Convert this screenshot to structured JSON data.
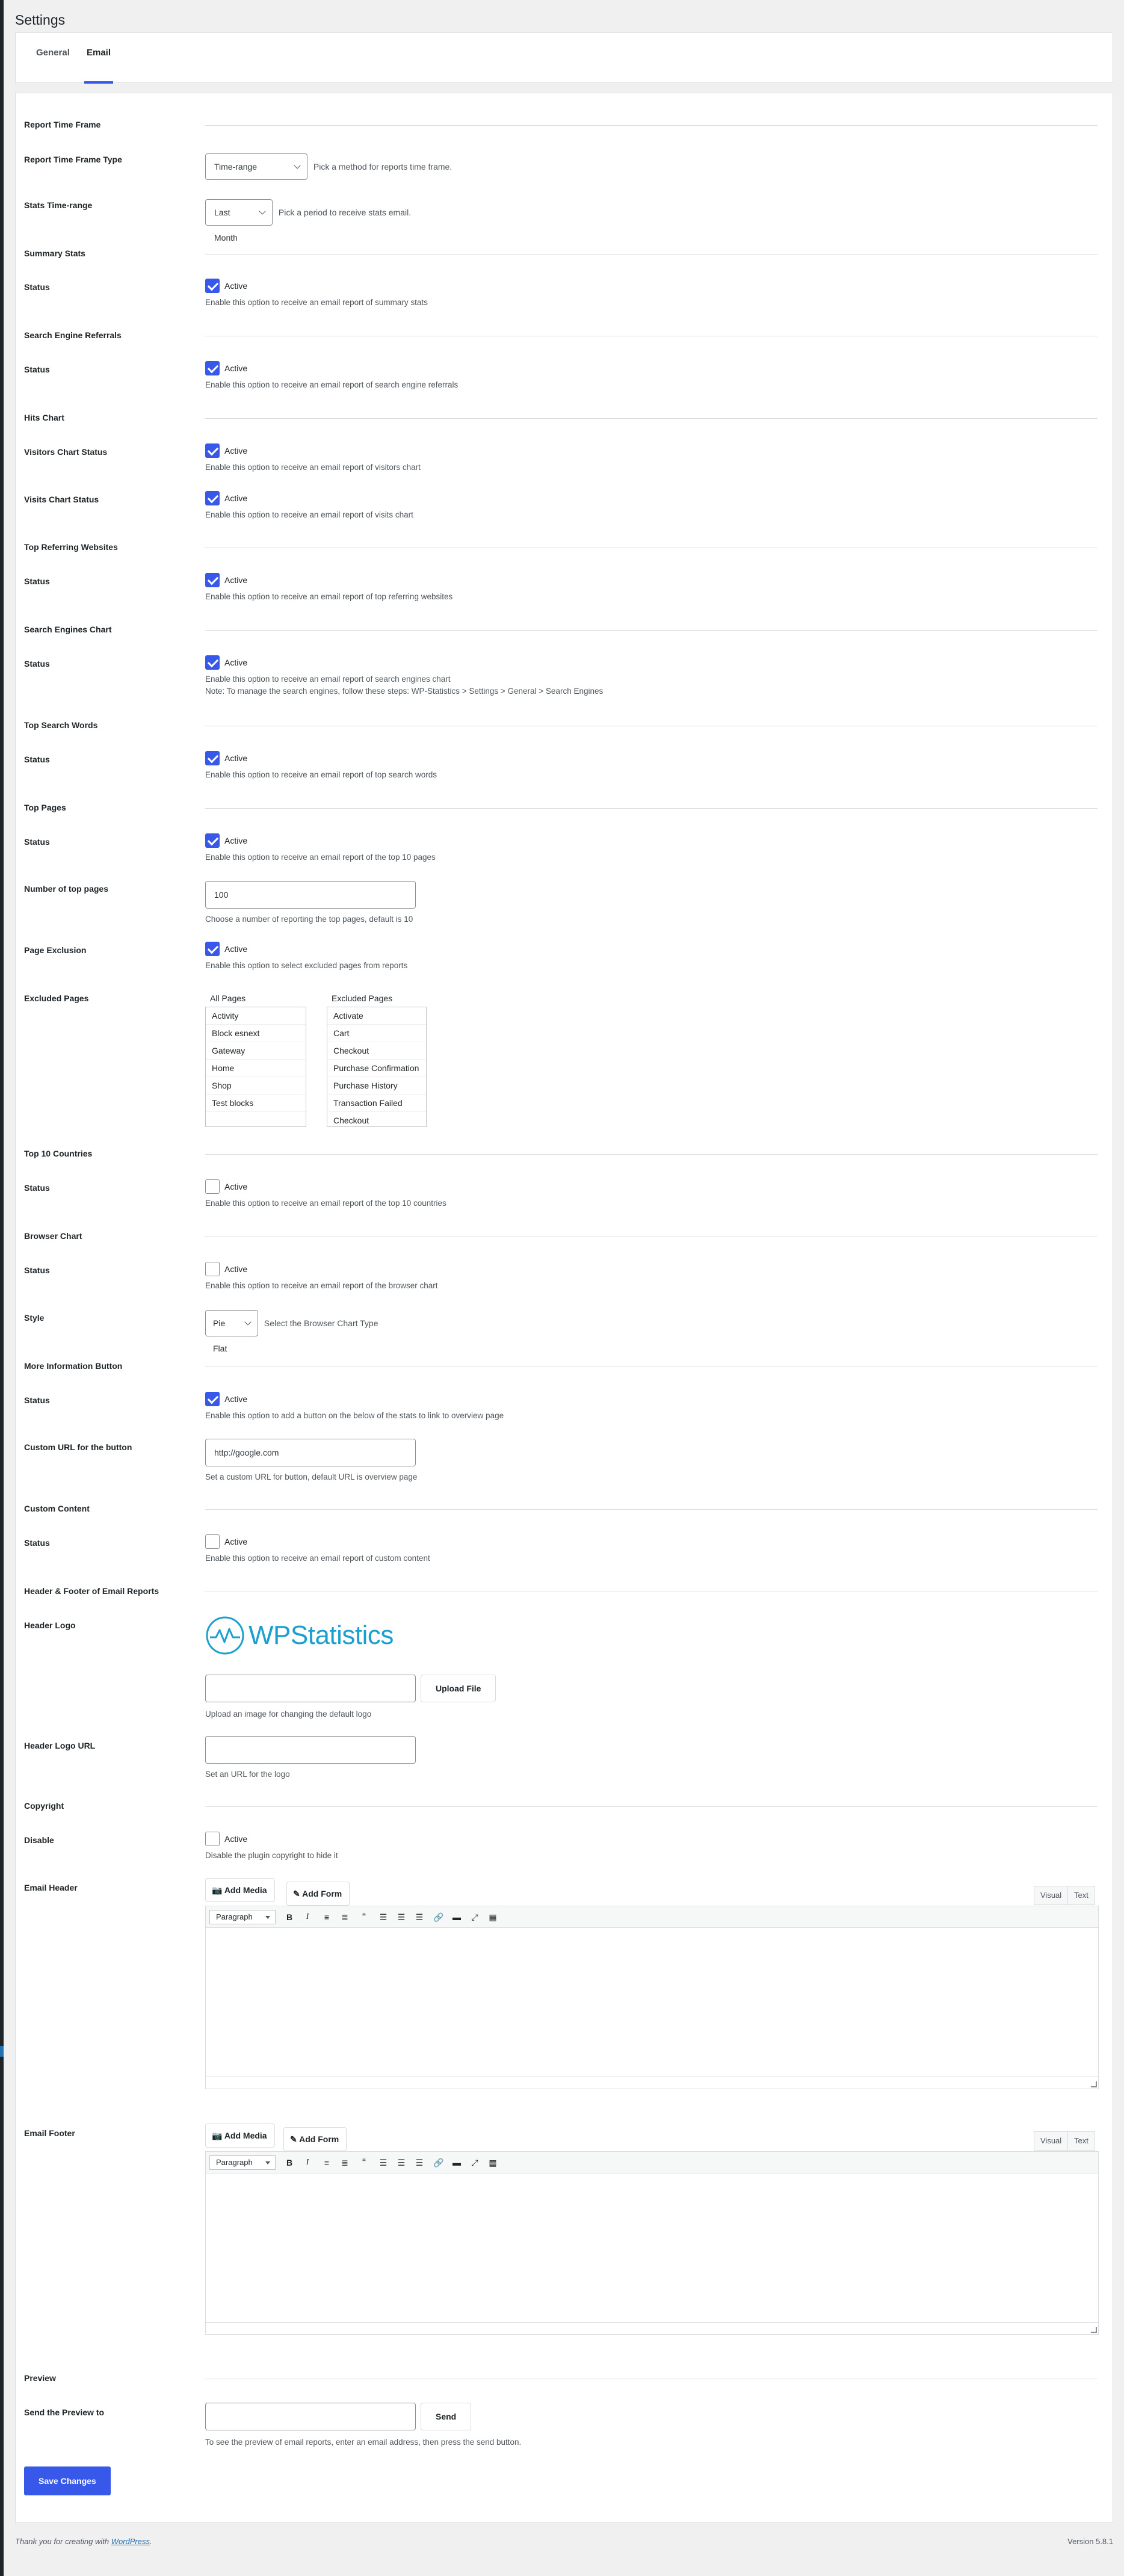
{
  "page": {
    "title": "Settings"
  },
  "tabs": [
    {
      "label": "General"
    },
    {
      "label": "Email"
    }
  ],
  "sections": {
    "report_time_frame": "Report Time Frame",
    "summary_stats": "Summary Stats",
    "search_engine_referrals": "Search Engine Referrals",
    "hits_chart": "Hits Chart",
    "top_referring": "Top Referring Websites",
    "search_engines_chart": "Search Engines Chart",
    "top_search_words": "Top Search Words",
    "top_pages": "Top Pages",
    "top_countries": "Top 10 Countries",
    "browser_chart": "Browser Chart",
    "more_info_button": "More Information Button",
    "custom_content": "Custom Content",
    "header_footer": "Header & Footer of Email Reports",
    "copyright": "Copyright",
    "preview": "Preview"
  },
  "labels": {
    "report_time_frame_type": "Report Time Frame Type",
    "stats_time_range": "Stats Time-range",
    "status": "Status",
    "visitors_chart_status": "Visitors Chart Status",
    "visits_chart_status": "Visits Chart Status",
    "number_top_pages": "Number of top pages",
    "page_exclusion": "Page Exclusion",
    "excluded_pages": "Excluded Pages",
    "style": "Style",
    "custom_url": "Custom URL for the button",
    "header_logo": "Header Logo",
    "header_logo_url": "Header Logo URL",
    "disable": "Disable",
    "email_header": "Email Header",
    "email_footer": "Email Footer",
    "send_preview": "Send the Preview to"
  },
  "fields": {
    "time_frame_type": {
      "value": "Time-range",
      "desc": "Pick a method for reports time frame."
    },
    "stats_range": {
      "value": "Last Month",
      "desc": "Pick a period to receive stats email."
    },
    "active_label": "Active",
    "summary_desc": "Enable this option to receive an email report of summary stats",
    "sref_desc": "Enable this option to receive an email report of search engine referrals",
    "visitors_desc": "Enable this option to receive an email report of visitors chart",
    "visits_desc": "Enable this option to receive an email report of visits chart",
    "top_ref_desc": "Enable this option to receive an email report of top referring websites",
    "se_chart_desc": "Enable this option to receive an email report of search engines chart",
    "se_chart_note": "Note: To manage the search engines, follow these steps: WP-Statistics > Settings > General > Search Engines",
    "top_words_desc": "Enable this option to receive an email report of top search words",
    "top_pages_desc": "Enable this option to receive an email report of the top 10 pages",
    "num_pages": {
      "value": "100",
      "desc": "Choose a number of reporting the top pages, default is 10"
    },
    "exclusion_desc": "Enable this option to select excluded pages from reports",
    "all_pages_head": "All Pages",
    "excluded_head": "Excluded Pages",
    "all_pages": [
      "Activity",
      "Block esnext",
      "Gateway",
      "Home",
      "Shop",
      "Test blocks"
    ],
    "excluded_pages": [
      "Activate",
      "Cart",
      "Checkout",
      "Purchase Confirmation",
      "Purchase History",
      "Transaction Failed",
      "Checkout"
    ],
    "countries_desc": "Enable this option to receive an email report of the top 10 countries",
    "browser_desc": "Enable this option to receive an email report of the browser chart",
    "style": {
      "value": "Pie Flat",
      "desc": "Select the Browser Chart Type"
    },
    "more_info_desc": "Enable this option to add a button on the below of the stats to link to overview page",
    "custom_url": {
      "value": "http://google.com",
      "desc": "Set a custom URL for button, default URL is overview page"
    },
    "custom_content_desc": "Enable this option to receive an email report of custom content",
    "logo_text": "WPStatistics",
    "upload_btn": "Upload File",
    "upload_desc": "Upload an image for changing the default logo",
    "logo_url_desc": "Set an URL for the logo",
    "copyright_desc": "Disable the plugin copyright to hide it",
    "add_media": "Add Media",
    "add_form": "Add Form",
    "visual": "Visual",
    "text": "Text",
    "paragraph": "Paragraph",
    "send_btn": "Send",
    "preview_desc": "To see the preview of email reports, enter an email address, then press the send button.",
    "save": "Save Changes"
  },
  "states": {
    "summary": true,
    "sref": true,
    "visitors": true,
    "visits": true,
    "top_ref": true,
    "se_chart": true,
    "top_words": true,
    "top_pages": true,
    "exclusion": true,
    "countries": false,
    "browser": false,
    "more_info": true,
    "custom_content": false,
    "copyright": false
  },
  "footer": {
    "thanks": "Thank you for creating with",
    "wp_link": "WordPress",
    "version": "Version 5.8.1"
  },
  "colors": {
    "accent": "#3858e9",
    "logo": "#1a9fd0"
  }
}
